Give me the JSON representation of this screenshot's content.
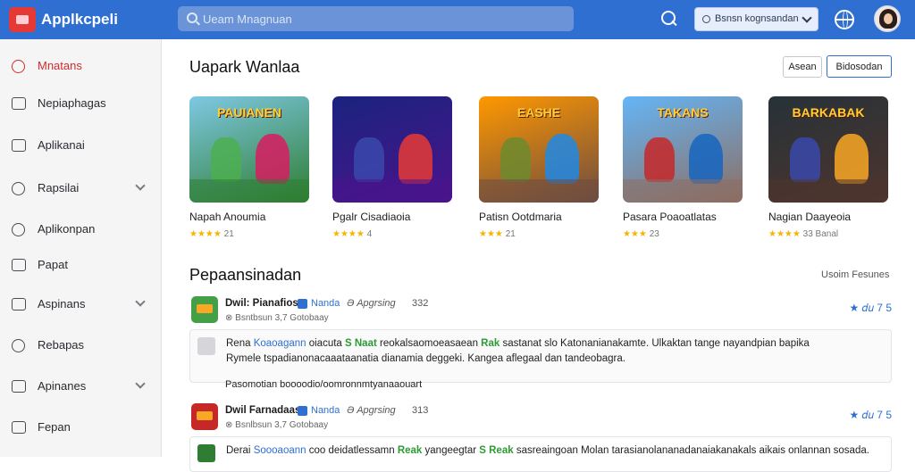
{
  "header": {
    "app_name": "Applkcpeli",
    "search_placeholder": "Ueam Mnagnuan",
    "account_select": "Bsnsn kognsandan"
  },
  "sidebar": {
    "items": [
      {
        "label": "Mnatans"
      },
      {
        "label": "Nepiaphagas"
      },
      {
        "label": "Aplikanai"
      },
      {
        "label": "Rapsilai"
      },
      {
        "label": "Aplikonpan"
      },
      {
        "label": "Papat"
      },
      {
        "label": "Aspinans"
      },
      {
        "label": "Rebapas"
      },
      {
        "label": "Apinanes"
      },
      {
        "label": "Fepan"
      }
    ]
  },
  "main": {
    "title": "Uapark Wanlaa",
    "apply_label": "Asean",
    "browse_label": "Bidosodan",
    "games": [
      {
        "name": "Napah Anoumia",
        "rating": "★★★★",
        "count": "21",
        "art": "PAUIANEN",
        "c1": "#4caf50",
        "c2": "#d81b60",
        "bg1": "#7ec8e3",
        "bg2": "#2e7d32"
      },
      {
        "name": "Pgalr Cisadiaoia",
        "rating": "★★★★",
        "count": "4",
        "art": "",
        "c1": "#3949ab",
        "c2": "#e53935",
        "bg1": "#1a237e",
        "bg2": "#4a148c"
      },
      {
        "name": "Patisn Ootdmaria",
        "rating": "★★★",
        "count": "21",
        "art": "EASHE",
        "c1": "#6d8b2e",
        "c2": "#1e88e5",
        "bg1": "#ff9800",
        "bg2": "#6d4c41"
      },
      {
        "name": "Pasara Poaoatlatas",
        "rating": "★★★",
        "count": "23",
        "art": "TAKANS",
        "c1": "#c62828",
        "c2": "#1565c0",
        "bg1": "#64b5f6",
        "bg2": "#8d6e63"
      },
      {
        "name": "Nagian Daayeoia",
        "rating": "★★★★",
        "count": "33 Banal",
        "art": "BARKABAK",
        "c1": "#3949ab",
        "c2": "#f9a825",
        "bg1": "#263238",
        "bg2": "#4e342e"
      }
    ],
    "section_title": "Pepaansinadan",
    "section_link": "Usoim Fesunes"
  },
  "reviews": [
    {
      "name": "Dwil: Pianafios",
      "tag": "Nanda",
      "meta": "Ə Apgrsing",
      "num": "332",
      "sub": "⊗ Bsntbsun 3,7 Gotobaay",
      "score": "★ 𝑑𝑢 7 5",
      "body_pre": "Rena ",
      "body_blue": "Koaoagann",
      "body_mid": " oiacuta ",
      "body_green1": "S Naat",
      "body_mid2": " reokalsaomoeasaean ",
      "body_green2": "Rak",
      "body_end": " sastanat slo Katonanianakamte. Ulkaktan tange nayandpian bapika",
      "body_line2": "Rymele tspadianonacaaataanatia dianamia deggeki. Kangea aflegaal dan tandeobagra.",
      "footer": "Pasomotian boooodio/oomronnmtyanaaouart",
      "icon_color": "#43a047",
      "icon_accent": "#f9a825"
    },
    {
      "name": "Dwil Farnadaas",
      "tag": "Nanda",
      "meta": "Ə Apgrsing",
      "num": "313",
      "sub": "⊗ Bsnlbsun 3,7 Gotobaay",
      "score": "★ 𝑑𝑢 7 5",
      "body_pre": "Derai ",
      "body_blue": "Soooaoann",
      "body_mid": " coo deidatlessamn ",
      "body_green1": "Reak",
      "body_mid2": " yangeegtar ",
      "body_green2": "S Reak",
      "body_end": " sasreaingoan Molan tarasianolananadanaiakanakals aikais onlannan sosada.",
      "body_line2": "",
      "footer": "",
      "icon_color": "#c62828",
      "icon_accent": "#f9a825"
    }
  ]
}
